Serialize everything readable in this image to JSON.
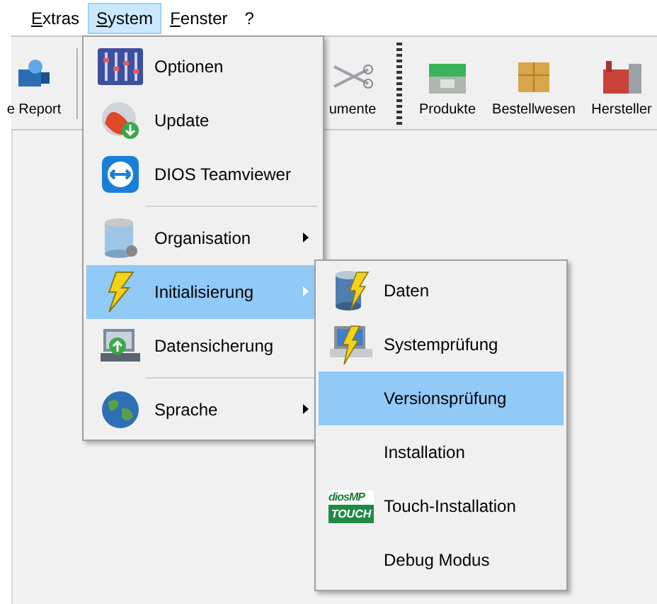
{
  "menubar": {
    "items": [
      {
        "label": "Extras",
        "selected": false
      },
      {
        "label": "System",
        "selected": true
      },
      {
        "label": "Fenster",
        "selected": false
      },
      {
        "label": "?",
        "selected": false
      }
    ]
  },
  "toolbar": {
    "buttons": [
      {
        "label": "e Report"
      },
      {
        "label": "umente"
      },
      {
        "label": "Produkte"
      },
      {
        "label": "Bestellwesen"
      },
      {
        "label": "Hersteller"
      }
    ]
  },
  "system_menu": {
    "items": [
      {
        "kind": "item",
        "label": "Optionen",
        "submenu": false,
        "selected": false
      },
      {
        "kind": "item",
        "label": "Update",
        "submenu": false,
        "selected": false
      },
      {
        "kind": "item",
        "label": "DIOS Teamviewer",
        "submenu": false,
        "selected": false
      },
      {
        "kind": "separator"
      },
      {
        "kind": "item",
        "label": "Organisation",
        "submenu": true,
        "selected": false
      },
      {
        "kind": "item",
        "label": "Initialisierung",
        "submenu": true,
        "selected": true
      },
      {
        "kind": "item",
        "label": "Datensicherung",
        "submenu": false,
        "selected": false
      },
      {
        "kind": "separator"
      },
      {
        "kind": "item",
        "label": "Sprache",
        "submenu": true,
        "selected": false
      }
    ]
  },
  "submenu": {
    "items": [
      {
        "label": "Daten",
        "selected": false
      },
      {
        "label": "Systemprüfung",
        "selected": false
      },
      {
        "label": "Versionsprüfung",
        "selected": true
      },
      {
        "label": "Installation",
        "selected": false
      },
      {
        "label": "Touch-Installation",
        "selected": false,
        "logo": {
          "top": "diosMP",
          "bottom": "TOUCH"
        }
      },
      {
        "label": "Debug Modus",
        "selected": false
      }
    ]
  }
}
